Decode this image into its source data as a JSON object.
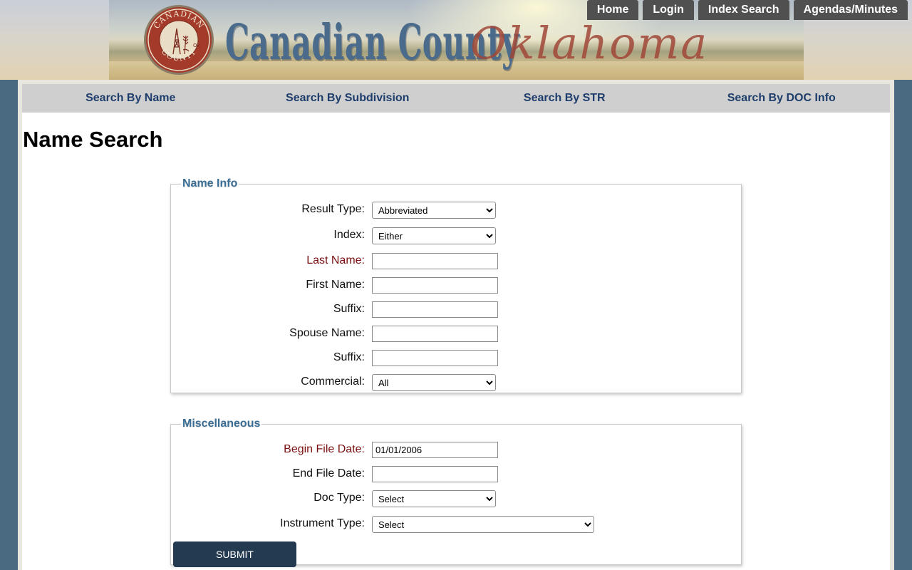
{
  "header": {
    "seal_text_top": "CANADIAN",
    "seal_text_bottom": "COUNTY",
    "seal_text_side": "OK",
    "title": "Canadian County",
    "script_title": "Oklahoma"
  },
  "topnav": {
    "home": "Home",
    "login": "Login",
    "index_search": "Index Search",
    "agendas": "Agendas/Minutes"
  },
  "subnav": {
    "by_name": "Search By Name",
    "by_subdivision": "Search By Subdivision",
    "by_str": "Search By STR",
    "by_doc": "Search By DOC Info"
  },
  "page": {
    "title": "Name Search"
  },
  "name_info": {
    "legend": "Name Info",
    "result_type": {
      "label": "Result Type:",
      "value": "Abbreviated"
    },
    "index": {
      "label": "Index:",
      "value": "Either"
    },
    "last_name": {
      "label": "Last Name:",
      "value": ""
    },
    "first_name": {
      "label": "First Name:",
      "value": ""
    },
    "suffix": {
      "label": "Suffix:",
      "value": ""
    },
    "spouse_name": {
      "label": "Spouse Name:",
      "value": ""
    },
    "spouse_suffix": {
      "label": "Suffix:",
      "value": ""
    },
    "commercial": {
      "label": "Commercial:",
      "value": "All"
    }
  },
  "misc": {
    "legend": "Miscellaneous",
    "begin_file_date": {
      "label": "Begin File Date:",
      "value": "01/01/2006"
    },
    "end_file_date": {
      "label": "End File Date:",
      "value": ""
    },
    "doc_type": {
      "label": "Doc Type:",
      "value": "Select"
    },
    "instrument_type": {
      "label": "Instrument Type:",
      "value": "Select"
    },
    "submit": "SUBMIT"
  },
  "colors": {
    "nav_button": "#505050",
    "subnav_link": "#1e3d6b",
    "legend": "#3b6e95",
    "required_label": "#7a1010",
    "submit_button": "#243a50",
    "side_background": "#4a6a82"
  }
}
